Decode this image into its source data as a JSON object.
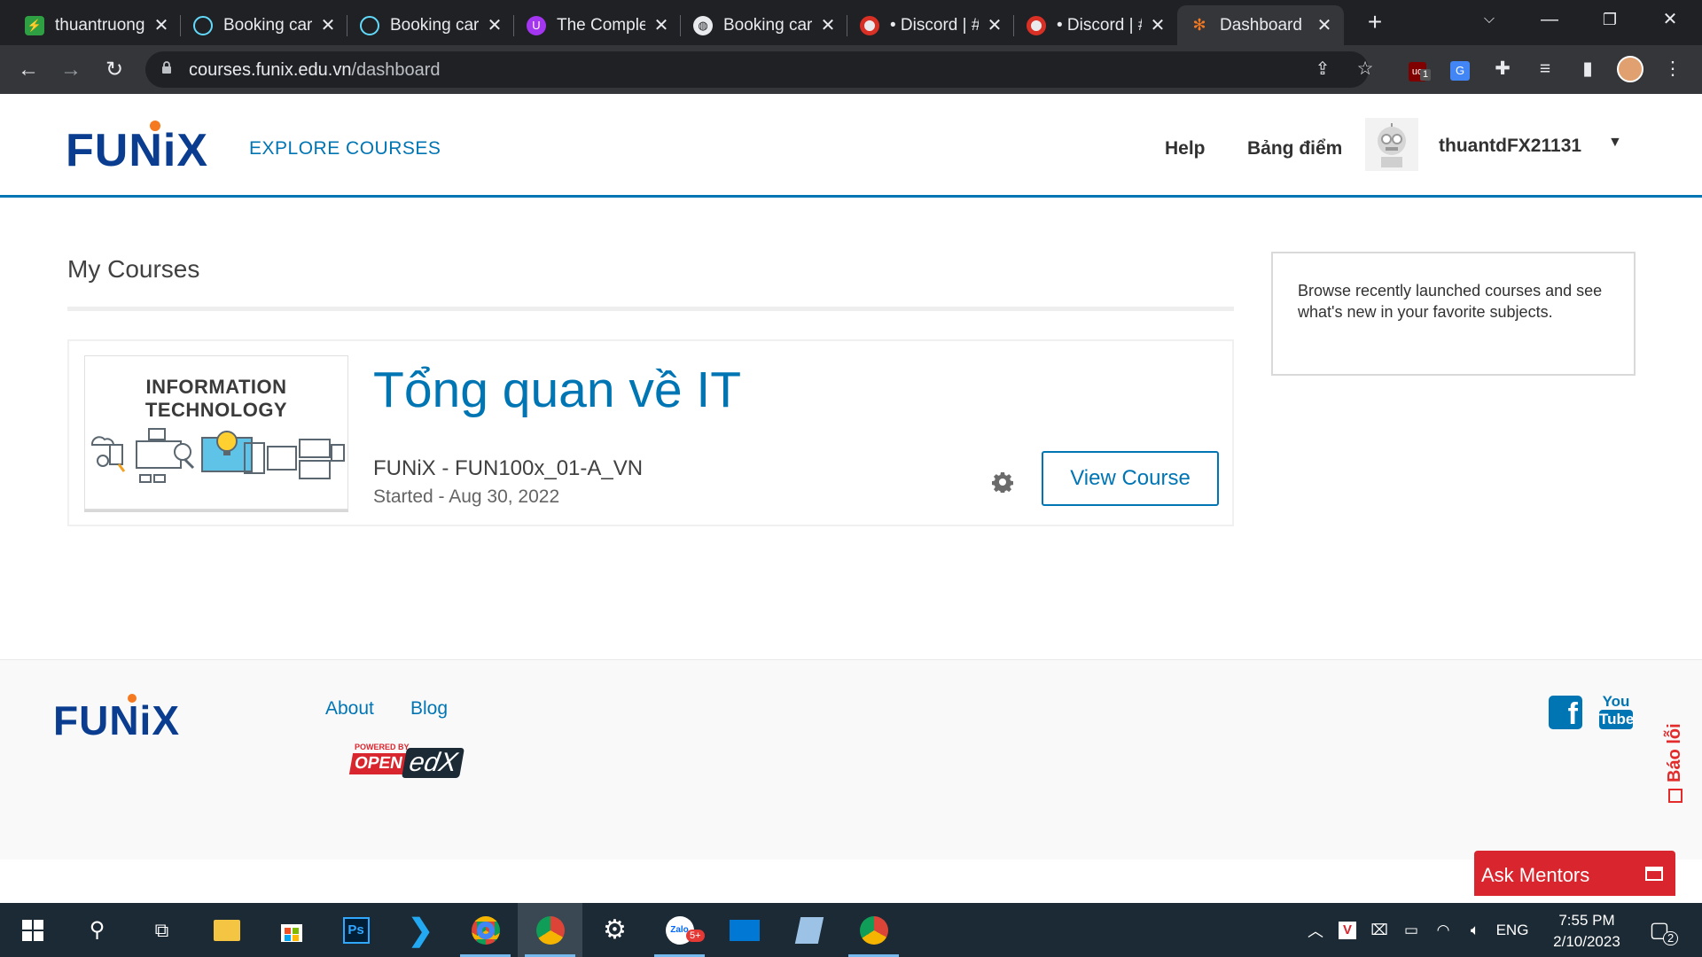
{
  "browser": {
    "tabs": [
      {
        "title": "thuantruong",
        "icon": "activity-icon",
        "color": "#2ea043"
      },
      {
        "title": "Booking car",
        "icon": "react-icon",
        "color": "#61dafb"
      },
      {
        "title": "Booking car",
        "icon": "react-icon",
        "color": "#61dafb"
      },
      {
        "title": "The Complete",
        "icon": "udemy-icon",
        "color": "#a435f0"
      },
      {
        "title": "Booking car",
        "icon": "globe-icon",
        "color": "#e8eaed"
      },
      {
        "title": "• Discord | #",
        "icon": "discord-icon",
        "color": "#5865f2"
      },
      {
        "title": "• Discord | #",
        "icon": "discord-icon",
        "color": "#5865f2"
      },
      {
        "title": "Dashboard",
        "icon": "funix-icon",
        "color": "#f47920"
      }
    ],
    "new_tab": "+",
    "url_host": "courses.funix.edu.vn",
    "url_path": "/dashboard",
    "ext_badge": "1"
  },
  "site": {
    "logo_text": "FUNiX",
    "explore": "EXPLORE COURSES",
    "help": "Help",
    "grades": "Bảng điểm",
    "username": "thuantdFX21131",
    "caret": "▼"
  },
  "main": {
    "heading": "My Courses",
    "course": {
      "image_title": "INFORMATION TECHNOLOGY",
      "title": "Tổng quan về IT",
      "code": "FUNiX - FUN100x_01-A_VN",
      "started": "Started - Aug 30, 2022",
      "view_button": "View Course"
    },
    "sidebar_text": "Browse recently launched courses and see what's new in your favorite subjects."
  },
  "footer": {
    "logo_text": "FUNiX",
    "about": "About",
    "blog": "Blog",
    "powered_by": "POWERED BY",
    "openedx_open": "OPEN",
    "openedx_edx": "edX",
    "youtube_you": "You",
    "youtube_tube": "Tube"
  },
  "widgets": {
    "report_bug": "Báo lỗi",
    "ask_mentors": "Ask Mentors"
  },
  "taskbar": {
    "lang": "ENG",
    "time": "7:55 PM",
    "date": "2/10/2023",
    "notif_count": "2",
    "zalo_badge": "5+",
    "ps_label": "Ps"
  },
  "colors": {
    "brand_blue": "#0075b4",
    "logo_navy": "#0a3d8f",
    "accent_orange": "#f47920",
    "ask_red": "#d9262e"
  }
}
